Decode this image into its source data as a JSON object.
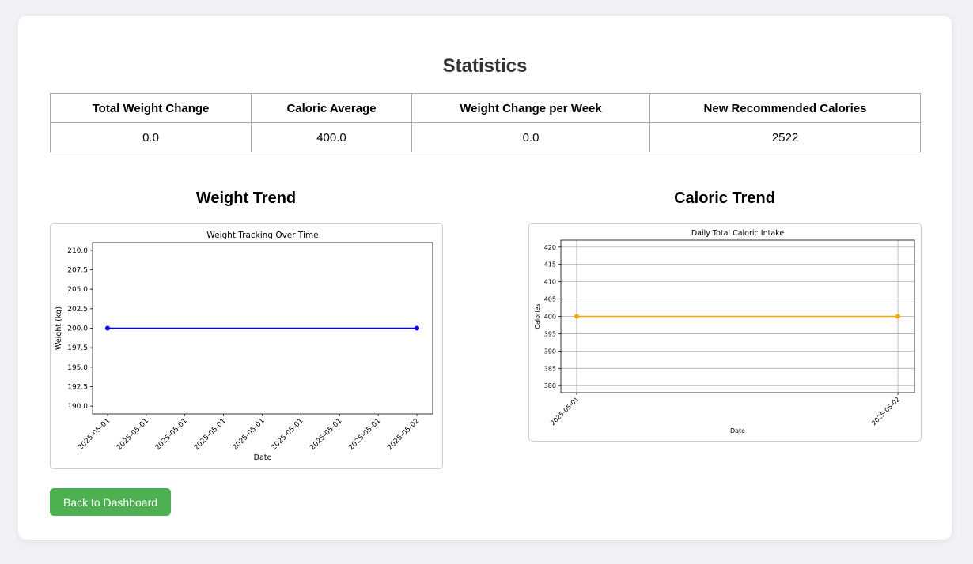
{
  "page": {
    "title": "Statistics"
  },
  "stats_table": {
    "headers": [
      "Total Weight Change",
      "Caloric Average",
      "Weight Change per Week",
      "New Recommended Calories"
    ],
    "values": [
      "0.0",
      "400.0",
      "0.0",
      "2522"
    ]
  },
  "sections": {
    "weight_title": "Weight Trend",
    "caloric_title": "Caloric Trend"
  },
  "chart_data": [
    {
      "type": "line",
      "title": "Weight Tracking Over Time",
      "xlabel": "Date",
      "ylabel": "Weight (kg)",
      "x_tick_labels": [
        "2025-05-01",
        "2025-05-01",
        "2025-05-01",
        "2025-05-01",
        "2025-05-01",
        "2025-05-01",
        "2025-05-01",
        "2025-05-01",
        "2025-05-02"
      ],
      "y_tick_labels": [
        "190.0",
        "192.5",
        "195.0",
        "197.5",
        "200.0",
        "202.5",
        "205.0",
        "207.5",
        "210.0"
      ],
      "ylim": [
        189,
        211
      ],
      "grid": false,
      "color": "#0000ff",
      "series": [
        {
          "x": [
            "2025-05-01",
            "2025-05-02"
          ],
          "values": [
            200.0,
            200.0
          ]
        }
      ]
    },
    {
      "type": "line",
      "title": "Daily Total Caloric Intake",
      "xlabel": "Date",
      "ylabel": "Calories",
      "x_tick_labels": [
        "2025-05-01",
        "2025-05-02"
      ],
      "y_tick_labels": [
        "380",
        "385",
        "390",
        "395",
        "400",
        "405",
        "410",
        "415",
        "420"
      ],
      "ylim": [
        378,
        422
      ],
      "grid": true,
      "color": "#ffa500",
      "series": [
        {
          "x": [
            "2025-05-01",
            "2025-05-02"
          ],
          "values": [
            400,
            400
          ]
        }
      ]
    }
  ],
  "actions": {
    "back_label": "Back to Dashboard"
  }
}
